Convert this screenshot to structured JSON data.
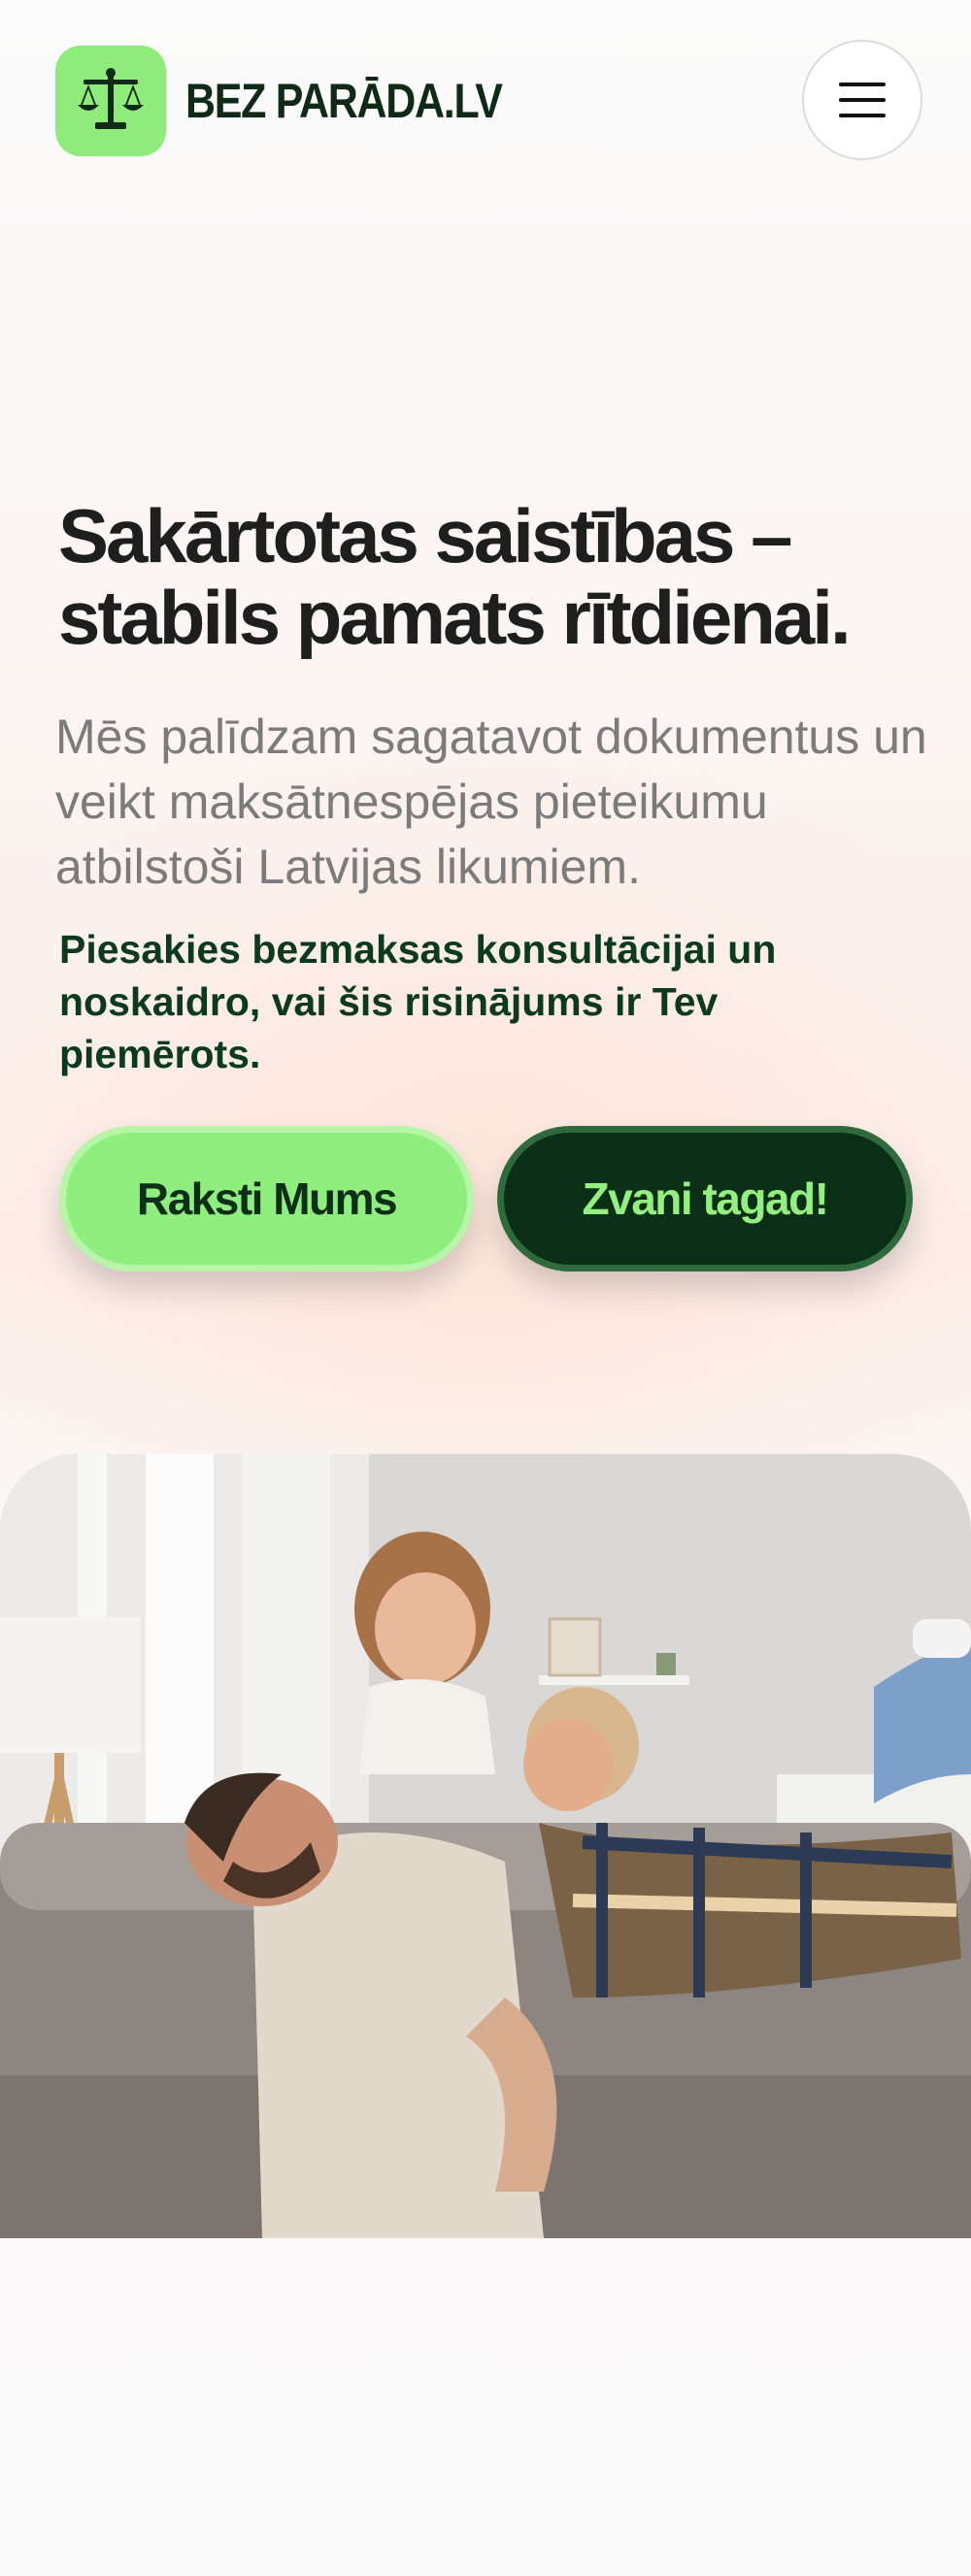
{
  "header": {
    "logo_text": "BEZ PARĀDA.LV",
    "logo_icon": "scales-icon",
    "menu_icon": "hamburger-menu-icon"
  },
  "hero": {
    "title": "Sakārtotas saistības – stabils pamats rītdienai.",
    "subtitle": "Mēs palīdzam sagatavot dokumentus un veikt maksātnespējas pieteikumu atbilstoši Latvijas likumiem.",
    "cta_text": "Piesakies bezmaksas konsultācijai un noskaidro, vai šis risinājums ir Tev piemērots.",
    "write_button": "Raksti Mums",
    "call_button": "Zvani tagad!"
  },
  "photo": {
    "subject": "family-photo"
  },
  "colors": {
    "accent_green": "#8fef7e",
    "dark_green": "#0b2e16",
    "text_dark": "#1e1e1e",
    "text_muted": "#7b7b7b"
  }
}
